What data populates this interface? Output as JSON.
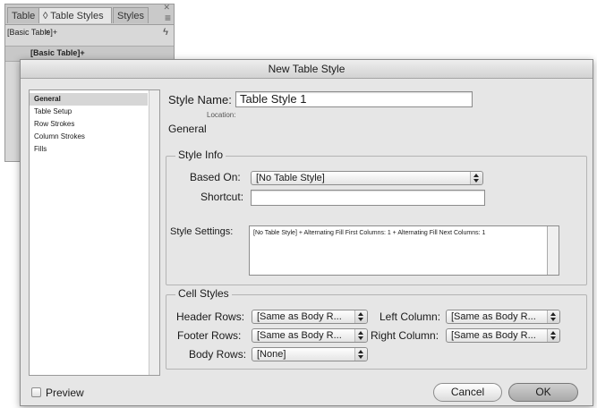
{
  "panel": {
    "tabs": [
      {
        "label": "Table"
      },
      {
        "label": "◊ Table Styles"
      },
      {
        "label": "Styles"
      }
    ],
    "tab_close": "×",
    "current_style": "[Basic Table]+",
    "list_item": "[Basic Table]+"
  },
  "dialog": {
    "title": "New Table Style",
    "style_name_label": "Style Name:",
    "style_name_value": "Table Style 1",
    "location_label": "Location:",
    "section_title": "General",
    "sidebar": {
      "items": [
        {
          "label": "General",
          "selected": true
        },
        {
          "label": "Table Setup"
        },
        {
          "label": "Row Strokes"
        },
        {
          "label": "Column Strokes"
        },
        {
          "label": "Fills"
        }
      ]
    },
    "style_info": {
      "title": "Style Info",
      "based_on_label": "Based On:",
      "based_on_value": "[No Table Style]",
      "shortcut_label": "Shortcut:",
      "shortcut_value": "",
      "settings_label": "Style Settings:",
      "settings_value": "[No Table Style] + Alternating Fill First Columns: 1 + Alternating Fill Next Columns: 1"
    },
    "cell_styles": {
      "title": "Cell Styles",
      "header_rows_label": "Header Rows:",
      "header_rows_value": "[Same as Body R...",
      "footer_rows_label": "Footer Rows:",
      "footer_rows_value": "[Same as Body R...",
      "body_rows_label": "Body Rows:",
      "body_rows_value": "[None]",
      "left_column_label": "Left Column:",
      "left_column_value": "[Same as Body R...",
      "right_column_label": "Right Column:",
      "right_column_value": "[Same as Body R..."
    },
    "preview_label": "Preview",
    "cancel_label": "Cancel",
    "ok_label": "OK"
  }
}
